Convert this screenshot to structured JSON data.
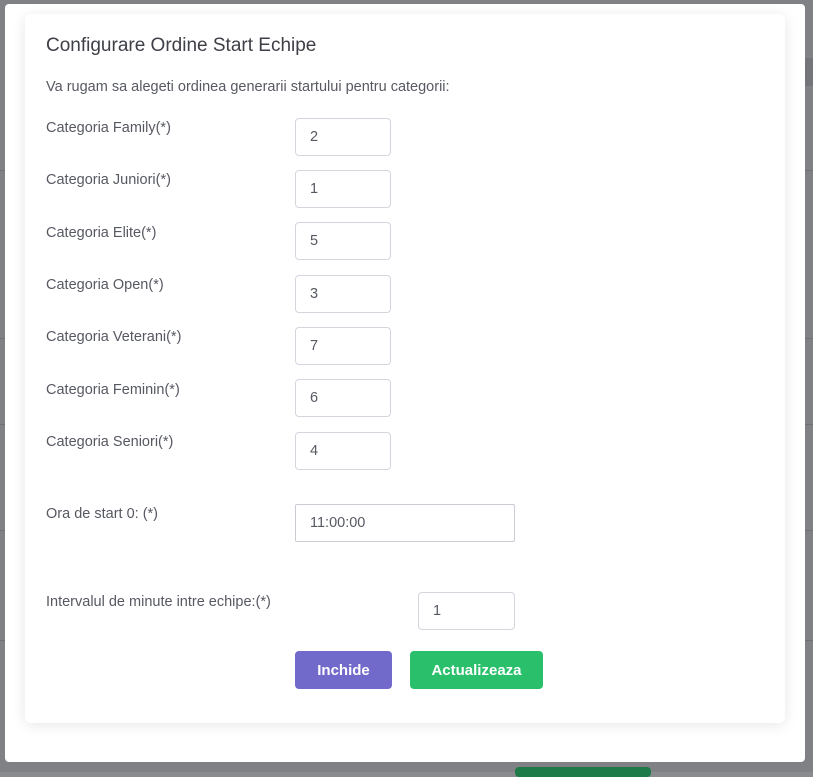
{
  "modal": {
    "title": "Configurare Ordine Start Echipe",
    "intro": "Va rugam sa alegeti ordinea generarii startului pentru categorii:"
  },
  "categories": [
    {
      "label": "Categoria Family(*)",
      "value": "2"
    },
    {
      "label": "Categoria Juniori(*)",
      "value": "1"
    },
    {
      "label": "Categoria Elite(*)",
      "value": "5"
    },
    {
      "label": "Categoria Open(*)",
      "value": "3"
    },
    {
      "label": "Categoria Veterani(*)",
      "value": "7"
    },
    {
      "label": "Categoria Feminin(*)",
      "value": "6"
    },
    {
      "label": "Categoria Seniori(*)",
      "value": "4"
    }
  ],
  "start_time": {
    "label": "Ora de start 0: (*)",
    "value": "11:00:00"
  },
  "interval": {
    "label": "Intervalul de minute intre echipe:(*)",
    "value": "1"
  },
  "buttons": {
    "close_label": "Inchide",
    "update_label": "Actualizeaza"
  },
  "colors": {
    "close_button": "#716aca",
    "update_button": "#2ac06b",
    "text": "#575962",
    "overlay": "#808184"
  }
}
